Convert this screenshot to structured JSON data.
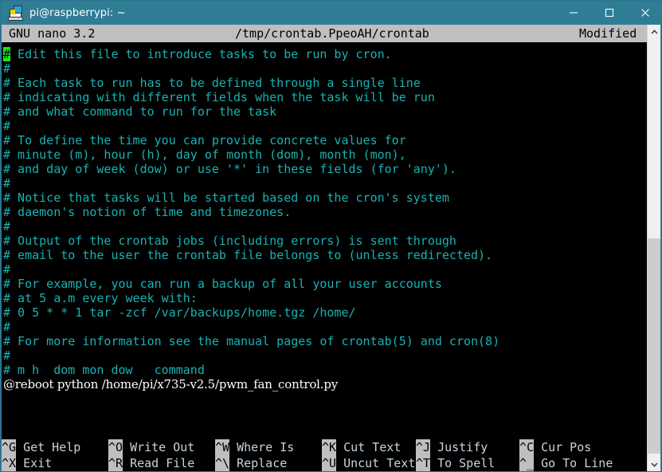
{
  "window": {
    "title": "pi@raspberrypi: ~",
    "icon": "putty-terminal-icon",
    "accent_color": "#2e7d95",
    "controls": {
      "minimize": "minimize-icon",
      "maximize": "maximize-icon",
      "close": "close-icon"
    }
  },
  "nano": {
    "version": "GNU nano 3.2",
    "filename": "/tmp/crontab.PpeoAH/crontab",
    "status": "Modified",
    "cursor_char": "#",
    "colors": {
      "comment": "#18b2b2",
      "command": "#ffffff",
      "cursor": "#18ea18",
      "inverse_bg": "#bfbfbf",
      "background": "#000000"
    },
    "lines": [
      {
        "cursor": true,
        "prefix": "#",
        "text": " Edit this file to introduce tasks to be run by cron."
      },
      {
        "prefix": "#",
        "text": ""
      },
      {
        "prefix": "#",
        "text": " Each task to run has to be defined through a single line"
      },
      {
        "prefix": "#",
        "text": " indicating with different fields when the task will be run"
      },
      {
        "prefix": "#",
        "text": " and what command to run for the task"
      },
      {
        "prefix": "#",
        "text": ""
      },
      {
        "prefix": "#",
        "text": " To define the time you can provide concrete values for"
      },
      {
        "prefix": "#",
        "text": " minute (m), hour (h), day of month (dom), month (mon),"
      },
      {
        "prefix": "#",
        "text": " and day of week (dow) or use '*' in these fields (for 'any')."
      },
      {
        "prefix": "#",
        "text": ""
      },
      {
        "prefix": "#",
        "text": " Notice that tasks will be started based on the cron's system"
      },
      {
        "prefix": "#",
        "text": " daemon's notion of time and timezones."
      },
      {
        "prefix": "#",
        "text": ""
      },
      {
        "prefix": "#",
        "text": " Output of the crontab jobs (including errors) is sent through"
      },
      {
        "prefix": "#",
        "text": " email to the user the crontab file belongs to (unless redirected)."
      },
      {
        "prefix": "#",
        "text": ""
      },
      {
        "prefix": "#",
        "text": " For example, you can run a backup of all your user accounts"
      },
      {
        "prefix": "#",
        "text": " at 5 a.m every week with:"
      },
      {
        "prefix": "#",
        "text": " 0 5 * * 1 tar -zcf /var/backups/home.tgz /home/"
      },
      {
        "prefix": "#",
        "text": ""
      },
      {
        "prefix": "#",
        "text": " For more information see the manual pages of crontab(5) and cron(8)"
      },
      {
        "prefix": "#",
        "text": ""
      },
      {
        "prefix": "#",
        "text": " m h  dom mon dow   command"
      }
    ],
    "command_line": "@reboot python /home/pi/x735-v2.5/pwm_fan_control.py",
    "shortcuts_row1": [
      {
        "key": "^G",
        "label": "Get Help"
      },
      {
        "key": "^O",
        "label": "Write Out"
      },
      {
        "key": "^W",
        "label": "Where Is"
      },
      {
        "key": "^K",
        "label": "Cut Text"
      },
      {
        "key": "^J",
        "label": "Justify"
      },
      {
        "key": "^C",
        "label": "Cur Pos"
      }
    ],
    "shortcuts_row2": [
      {
        "key": "^X",
        "label": "Exit"
      },
      {
        "key": "^R",
        "label": "Read File"
      },
      {
        "key": "^\\",
        "label": "Replace"
      },
      {
        "key": "^U",
        "label": "Uncut Text"
      },
      {
        "key": "^T",
        "label": "To Spell"
      },
      {
        "key": "^_",
        "label": "Go To Line"
      }
    ]
  },
  "scrollbar": {
    "up_arrow": "chevron-up-icon",
    "down_arrow": "chevron-down-icon"
  }
}
